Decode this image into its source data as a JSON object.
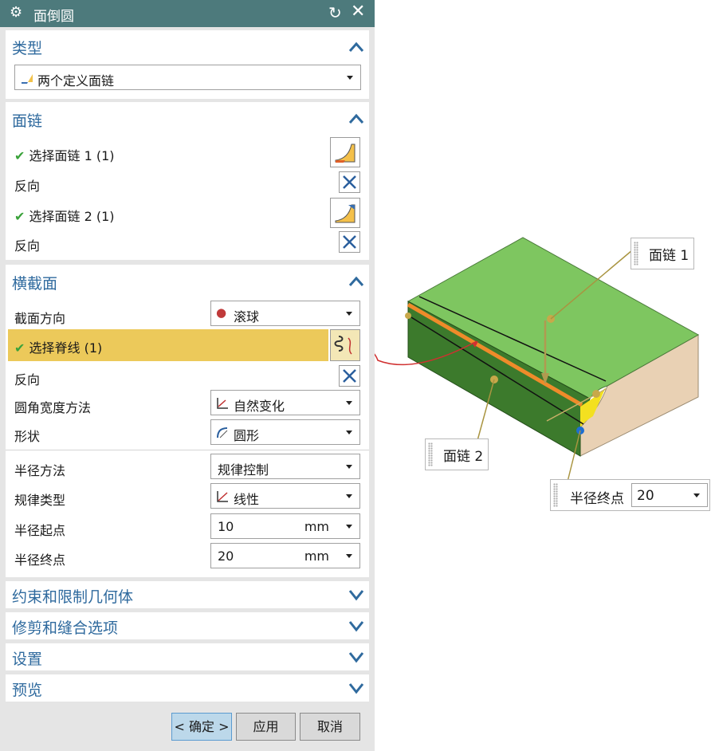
{
  "window": {
    "title": "面倒圆"
  },
  "sections": {
    "type": {
      "title": "类型",
      "dropdown": "两个定义面链"
    },
    "face_chain": {
      "title": "面链",
      "select1": "选择面链 1 (1)",
      "reverse1": "反向",
      "select2": "选择面链 2 (1)",
      "reverse2": "反向"
    },
    "cross_section": {
      "title": "横截面",
      "direction_label": "截面方向",
      "direction_value": "滚球",
      "spine_label": "选择脊线 (1)",
      "reverse": "反向",
      "width_method_label": "圆角宽度方法",
      "width_method_value": "自然变化",
      "shape_label": "形状",
      "shape_value": "圆形",
      "radius_method_label": "半径方法",
      "radius_method_value": "规律控制",
      "law_type_label": "规律类型",
      "law_type_value": "线性",
      "radius_start_label": "半径起点",
      "radius_start_value": "10",
      "radius_start_unit": "mm",
      "radius_end_label": "半径终点",
      "radius_end_value": "20",
      "radius_end_unit": "mm"
    },
    "collapsed": [
      "约束和限制几何体",
      "修剪和缝合选项",
      "设置",
      "预览"
    ]
  },
  "buttons": {
    "ok": "< 确定 >",
    "apply": "应用",
    "cancel": "取消"
  },
  "viewport": {
    "callout_chain1": "面链 1",
    "callout_chain2": "面链 2",
    "callout_end_label": "半径终点",
    "callout_end_value": "20"
  },
  "colors": {
    "titlebar": "#4d7a7c",
    "section_title": "#2f6a9e",
    "selected_row": "#ecc95a",
    "check": "#3aa23a",
    "face_top": "#7ec660",
    "face_front": "#3c7a2c",
    "face_side": "#e9d1b4",
    "edge_highlight": "#ef8b2a"
  }
}
